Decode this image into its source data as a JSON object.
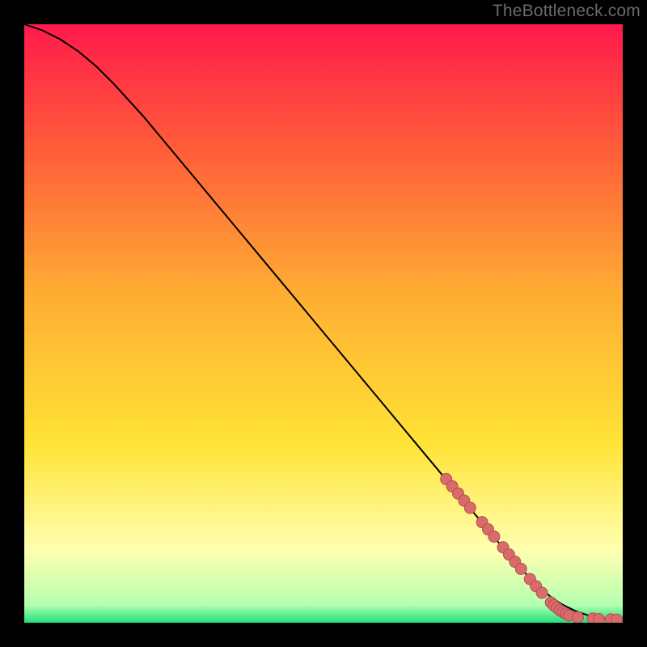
{
  "watermark": "TheBottleneck.com",
  "colors": {
    "plot_bg_top": "#ff1a4b",
    "plot_bg_upper": "#ff5a3a",
    "plot_bg_mid": "#ffad33",
    "plot_bg_lower": "#ffe336",
    "plot_bg_pale": "#ffffb0",
    "plot_bg_green": "#1fe07a",
    "frame_bg": "#000000",
    "curve": "#000000",
    "marker_fill": "#d96b6b",
    "marker_stroke": "#b74f4f"
  },
  "chart_data": {
    "type": "line",
    "title": "",
    "xlabel": "",
    "ylabel": "",
    "xlim": [
      0,
      100
    ],
    "ylim": [
      0,
      100
    ],
    "curve": {
      "x": [
        0,
        3,
        6,
        9,
        12,
        15,
        20,
        25,
        30,
        35,
        40,
        45,
        50,
        55,
        60,
        65,
        70,
        75,
        80,
        83,
        86,
        88,
        90,
        92,
        94,
        96,
        98,
        100
      ],
      "y": [
        100,
        99,
        97.5,
        95.5,
        93,
        90,
        84.5,
        78.5,
        72.5,
        66.5,
        60.5,
        54.5,
        48.5,
        42.5,
        36.5,
        30.5,
        24.5,
        18.5,
        12.5,
        9.0,
        6.0,
        4.3,
        3.0,
        2.0,
        1.3,
        0.9,
        0.6,
        0.5
      ]
    },
    "series": [
      {
        "name": "data-points",
        "x": [
          70.5,
          71.5,
          72.5,
          73.5,
          74.5,
          76.5,
          77.5,
          78.5,
          80.0,
          81.0,
          82.0,
          83.0,
          84.5,
          85.5,
          86.5,
          88.0,
          88.5,
          89.0,
          89.5,
          90.0,
          90.5,
          91.0,
          92.5,
          95.0,
          96.0,
          98.0,
          99.0
        ],
        "y": [
          24.0,
          22.8,
          21.6,
          20.4,
          19.2,
          16.8,
          15.6,
          14.4,
          12.6,
          11.4,
          10.2,
          9.0,
          7.3,
          6.1,
          5.0,
          3.4,
          2.9,
          2.5,
          2.1,
          1.8,
          1.5,
          1.2,
          0.9,
          0.7,
          0.6,
          0.55,
          0.5
        ]
      }
    ]
  }
}
